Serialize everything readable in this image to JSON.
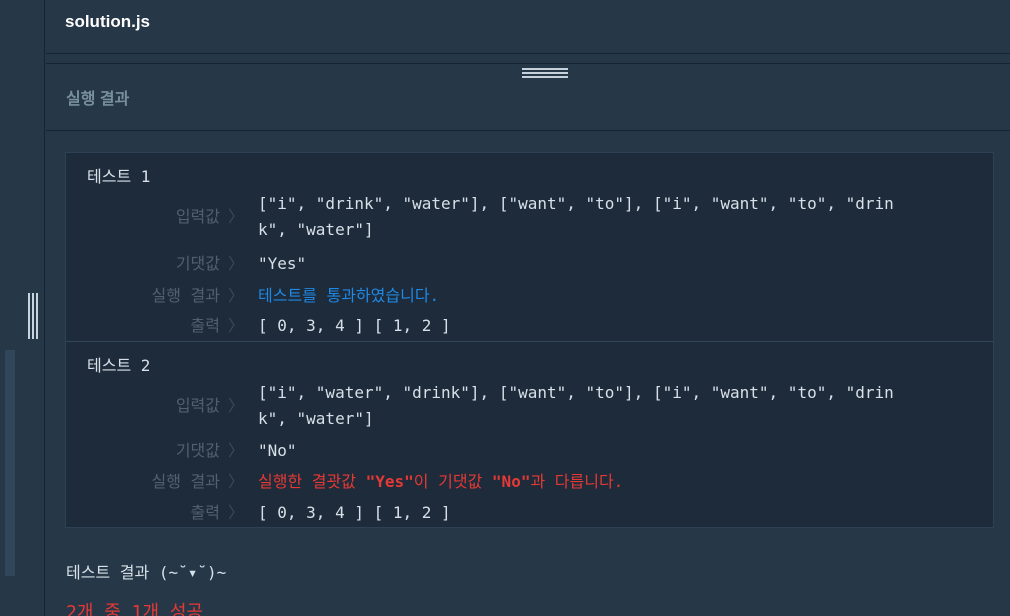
{
  "editor": {
    "filename": "solution.js"
  },
  "result_panel": {
    "title": "실행 결과"
  },
  "tests": [
    {
      "title": "테스트 1",
      "input_label": "입력값",
      "input_line1": "[\"i\", \"drink\", \"water\"], [\"want\", \"to\"], [\"i\", \"want\", \"to\", \"drin",
      "input_line2": "k\", \"water\"]",
      "expected_label": "기댓값",
      "expected": "\"Yes\"",
      "result_label": "실행 결과",
      "result": "테스트를 통과하였습니다.",
      "output_label": "출력",
      "output": "[ 0, 3, 4 ] [ 1, 2 ]"
    },
    {
      "title": "테스트 2",
      "input_label": "입력값",
      "input_line1": "[\"i\", \"water\", \"drink\"], [\"want\", \"to\"], [\"i\", \"want\", \"to\", \"drin",
      "input_line2": "k\", \"water\"]",
      "expected_label": "기댓값",
      "expected": "\"No\"",
      "result_label": "실행 결과",
      "result_prefix": "실행한 결괏값 ",
      "result_actual": "\"Yes\"",
      "result_middle": "이 기댓값 ",
      "result_expected": "\"No\"",
      "result_suffix": "과 다릅니다.",
      "output_label": "출력",
      "output": "[ 0, 3, 4 ] [ 1, 2 ]"
    }
  ],
  "summary": {
    "text": "테스트 결과 (~˘▾˘)~",
    "count": "2개 중 1개 성공"
  },
  "icons": {
    "chevron": "chevron-right-icon"
  },
  "colors": {
    "pass": "#1e88e5",
    "fail": "#e53935"
  }
}
